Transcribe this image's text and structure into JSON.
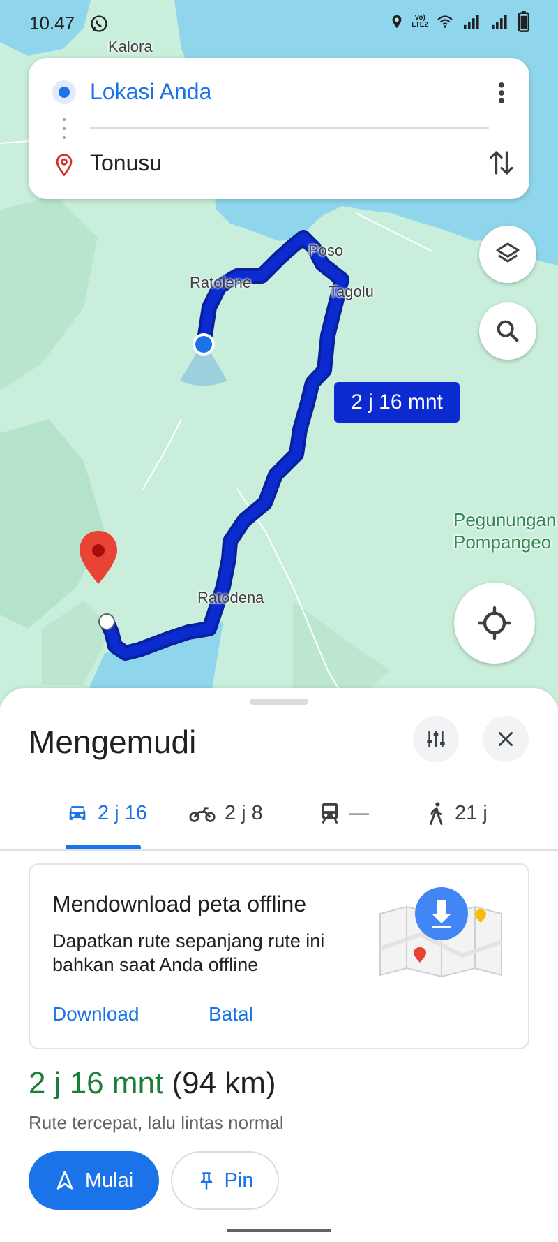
{
  "status_bar": {
    "time": "10.47",
    "icons": [
      "whatsapp-icon",
      "location-icon",
      "volte-icon",
      "wifi-icon",
      "signal-icon",
      "signal-icon",
      "battery-icon"
    ],
    "volte_text": "LTE2"
  },
  "map": {
    "labels": {
      "kalora": "Kalora",
      "poso": "Poso",
      "ratolene": "Ratolene",
      "tagolu": "Tagolu",
      "ratodena": "Ratodena",
      "pegunungan_line1": "Pegunungan",
      "pegunungan_line2": "Pompangeo"
    },
    "route_time_bubble": "2 j 16 mnt",
    "colors": {
      "land": "#c9efdc",
      "water": "#8fd6ec",
      "route": "#0b2bd1"
    }
  },
  "route_card": {
    "origin": "Lokasi Anda",
    "destination": "Tonusu"
  },
  "sheet": {
    "title": "Mengemudi",
    "tabs": [
      {
        "label": "2 j 16",
        "icon": "car-icon",
        "active": true
      },
      {
        "label": "2 j 8",
        "icon": "motorcycle-icon",
        "active": false
      },
      {
        "label": "—",
        "icon": "transit-icon",
        "active": false
      },
      {
        "label": "21 j",
        "icon": "walk-icon",
        "active": false
      }
    ],
    "offline_card": {
      "title": "Mendownload peta offline",
      "description": "Dapatkan rute sepanjang rute ini bahkan saat Anda offline",
      "download_label": "Download",
      "cancel_label": "Batal"
    },
    "summary": {
      "duration": "2 j 16 mnt",
      "distance": "(94 km)",
      "description": "Rute tercepat, lalu lintas normal"
    },
    "start_label": "Mulai",
    "pin_label": "Pin"
  }
}
